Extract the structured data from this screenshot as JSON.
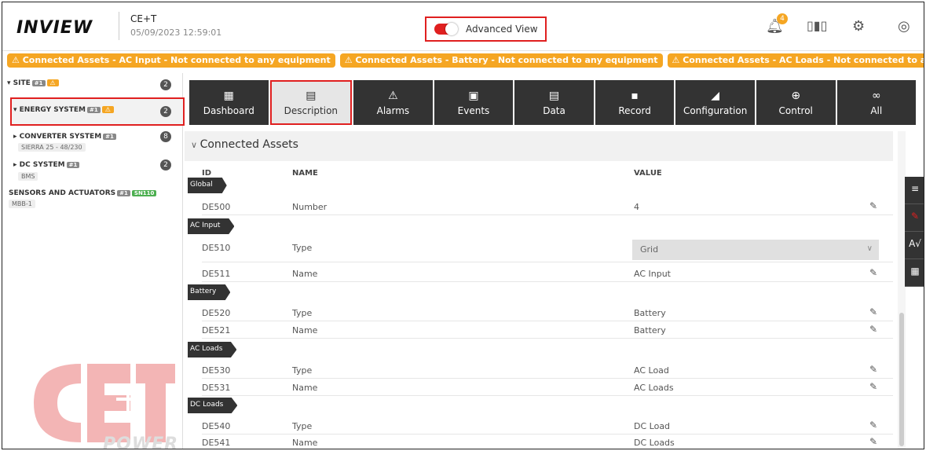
{
  "header": {
    "logo": "INVIEW",
    "site_name": "CE+T",
    "site_datetime": "05/09/2023 12:59:01",
    "advanced_view_label": "Advanced View",
    "advanced_view_on": true,
    "notification_count": "4",
    "icons": [
      "bell-icon",
      "bar-chart-icon",
      "gear-icon",
      "user-icon"
    ],
    "accent_color": "#e02020"
  },
  "alerts": [
    "⚠ Connected Assets - AC Input - Not connected to any equipment",
    "⚠ Connected Assets - Battery - Not connected to any equipment",
    "⚠ Connected Assets - AC Loads - Not connected to any equ"
  ],
  "sidebar": {
    "site": {
      "label": "▾ SITE",
      "tag": "#1",
      "count": "2"
    },
    "energy_system": {
      "label": "▾ ENERGY SYSTEM",
      "tag": "#1",
      "count": "2"
    },
    "converter_system": {
      "label": "▸ CONVERTER SYSTEM",
      "tag": "#1",
      "sub": "SIERRA 25 - 48/230",
      "count": "8"
    },
    "dc_system": {
      "label": "▸ DC SYSTEM",
      "tag": "#1",
      "sub": "BMS",
      "count": "2"
    },
    "sensors": {
      "label": "SENSORS AND ACTUATORS",
      "tag": "#1",
      "tag2": "SN110",
      "sub": "MBB-1"
    },
    "watermark_logo": "CE+T",
    "watermark_text": "POWER"
  },
  "tabs": [
    {
      "label": "Dashboard",
      "icon": "dashboard-icon",
      "glyph": "▦",
      "active": false
    },
    {
      "label": "Description",
      "icon": "document-icon",
      "glyph": "▤",
      "active": true
    },
    {
      "label": "Alarms",
      "icon": "alarm-icon",
      "glyph": "⚠",
      "active": false
    },
    {
      "label": "Events",
      "icon": "calendar-icon",
      "glyph": "▣",
      "active": false
    },
    {
      "label": "Data",
      "icon": "data-icon",
      "glyph": "▤",
      "active": false
    },
    {
      "label": "Record",
      "icon": "record-icon",
      "glyph": "▪",
      "active": false
    },
    {
      "label": "Configuration",
      "icon": "configuration-icon",
      "glyph": "◢",
      "active": false
    },
    {
      "label": "Control",
      "icon": "control-icon",
      "glyph": "⊕",
      "active": false
    },
    {
      "label": "All",
      "icon": "infinity-icon",
      "glyph": "∞",
      "active": false
    }
  ],
  "content": {
    "section_title": "Connected Assets",
    "columns": {
      "id": "ID",
      "name": "NAME",
      "value": "VALUE"
    },
    "groups": {
      "global": "Global",
      "ac_input": "AC Input",
      "battery": "Battery",
      "ac_loads": "AC Loads",
      "dc_loads": "DC Loads"
    },
    "rows": [
      {
        "id": "DE500",
        "name": "Number",
        "value": "4"
      },
      {
        "id": "DE510",
        "name": "Type",
        "value": "Grid"
      },
      {
        "id": "DE511",
        "name": "Name",
        "value": "AC Input"
      },
      {
        "id": "DE520",
        "name": "Type",
        "value": "Battery"
      },
      {
        "id": "DE521",
        "name": "Name",
        "value": "Battery"
      },
      {
        "id": "DE530",
        "name": "Type",
        "value": "AC Load"
      },
      {
        "id": "DE531",
        "name": "Name",
        "value": "AC Loads"
      },
      {
        "id": "DE540",
        "name": "Type",
        "value": "DC Load"
      },
      {
        "id": "DE541",
        "name": "Name",
        "value": "DC Loads"
      }
    ]
  },
  "toolstrip": [
    "filter-icon",
    "pen-icon",
    "spellcheck-icon",
    "layout-icon"
  ]
}
